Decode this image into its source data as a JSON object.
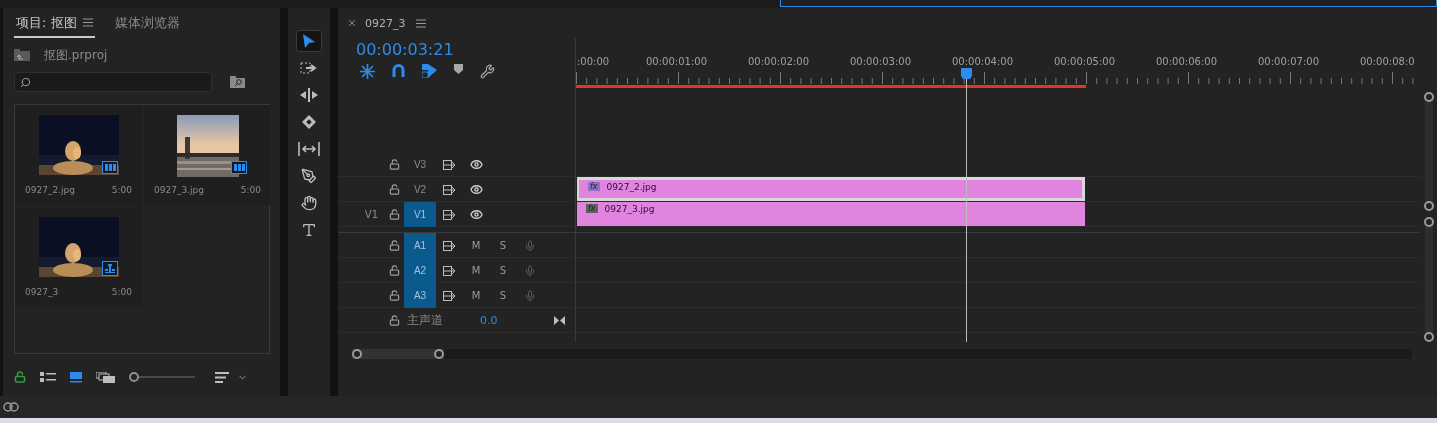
{
  "project_panel": {
    "tabs": [
      {
        "label": "项目: 抠图",
        "selected": true
      },
      {
        "label": "媒体浏览器",
        "selected": false
      }
    ],
    "path": "抠图.prproj",
    "items": [
      {
        "name": "0927_2.jpg",
        "duration": "5:00",
        "kind": "footage"
      },
      {
        "name": "0927_3.jpg",
        "duration": "5:00",
        "kind": "footage"
      },
      {
        "name": "0927_3",
        "duration": "5:00",
        "kind": "sequence"
      }
    ],
    "view_modes": [
      {
        "kind": "list",
        "selected": false
      },
      {
        "kind": "icon",
        "selected": true
      },
      {
        "kind": "freeform",
        "selected": false
      }
    ],
    "zoom": {
      "level": 0
    }
  },
  "tools": [
    {
      "kind": "selection",
      "selected": true
    },
    {
      "kind": "track-select",
      "selected": false
    },
    {
      "kind": "ripple",
      "selected": false
    },
    {
      "kind": "razor",
      "selected": false
    },
    {
      "kind": "slip",
      "selected": false
    },
    {
      "kind": "pen",
      "selected": false
    },
    {
      "kind": "hand",
      "selected": false
    },
    {
      "kind": "type",
      "selected": false
    }
  ],
  "timeline": {
    "tab": "0927_3",
    "timecode": "00:00:03:21",
    "tools": [
      {
        "kind": "nest",
        "on": true
      },
      {
        "kind": "snap",
        "on": true
      },
      {
        "kind": "linked",
        "on": true
      },
      {
        "kind": "marker",
        "on": false
      },
      {
        "kind": "settings",
        "on": false
      }
    ],
    "ruler": [
      ":00:00",
      "00:00:01:00",
      "00:00:02:00",
      "00:00:03:00",
      "00:00:04:00",
      "00:00:05:00",
      "00:00:06:00",
      "00:00:07:00",
      "00:00:08:0"
    ],
    "video_tracks": [
      {
        "name": "V3",
        "targeted": false
      },
      {
        "name": "V2",
        "targeted": false,
        "clips": [
          {
            "name": "0927_2.jpg",
            "badge": "fx",
            "fx_active": true,
            "selected": true
          }
        ]
      },
      {
        "source": "V1",
        "name": "V1",
        "targeted": true,
        "clips": [
          {
            "name": "0927_3.jpg",
            "badge": "fx",
            "fx_active": false,
            "selected": false
          }
        ]
      }
    ],
    "audio_tracks": [
      {
        "name": "A1",
        "targeted": true,
        "mute": "M",
        "solo": "S"
      },
      {
        "name": "A2",
        "targeted": true,
        "mute": "M",
        "solo": "S"
      },
      {
        "name": "A3",
        "targeted": true,
        "mute": "M",
        "solo": "S"
      }
    ],
    "master": {
      "label": "主声道",
      "value": "0.0"
    }
  }
}
